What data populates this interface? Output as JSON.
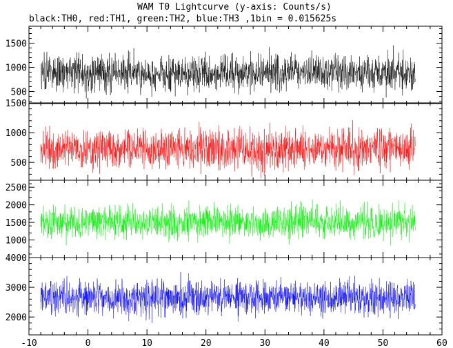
{
  "chart_data": {
    "type": "line",
    "title": "WAM T0 Lightcurve (y-axis: Counts/s)",
    "subtitle": "black:TH0, red:TH1, green:TH2, blue:TH3 ,1bin = 0.015625s",
    "xlim": [
      -10,
      60
    ],
    "x_ticks": [
      -10,
      0,
      10,
      20,
      30,
      40,
      50,
      60
    ],
    "x_range": [
      -8.0,
      55.5
    ],
    "bin_width_s": 0.015625,
    "panels": [
      {
        "name": "TH0",
        "color": "#000000",
        "ylim": [
          250,
          1850
        ],
        "y_ticks": [
          500,
          1000,
          1500
        ],
        "baseline": 880,
        "noise_amplitude": 340
      },
      {
        "name": "TH1",
        "color": "#ff0000",
        "ylim": [
          200,
          1500
        ],
        "y_ticks": [
          500,
          1000,
          1500
        ],
        "baseline": 730,
        "noise_amplitude": 300
      },
      {
        "name": "TH2",
        "color": "#00ee00",
        "ylim": [
          500,
          2700
        ],
        "y_ticks": [
          1000,
          1500,
          2000,
          2500
        ],
        "baseline": 1500,
        "noise_amplitude": 420
      },
      {
        "name": "TH3",
        "color": "#0000ff",
        "ylim": [
          1400,
          4000
        ],
        "y_ticks": [
          2000,
          3000,
          4000
        ],
        "baseline": 2650,
        "noise_amplitude": 520
      }
    ]
  }
}
